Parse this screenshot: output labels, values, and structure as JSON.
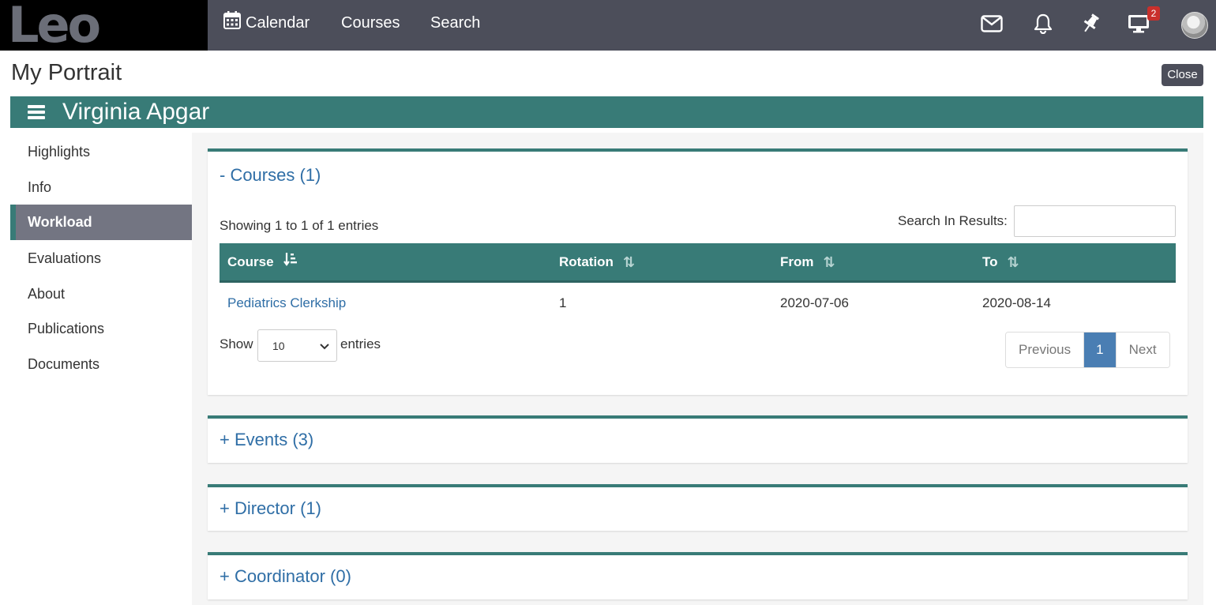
{
  "app": {
    "logo": "Leo"
  },
  "topnav": {
    "calendar": "Calendar",
    "courses": "Courses",
    "search": "Search",
    "notifications_badge": "2",
    "icons": [
      "calendar-icon",
      "mail-icon",
      "bell-icon",
      "pin-icon",
      "monitor-icon"
    ]
  },
  "page": {
    "title": "My Portrait",
    "close_label": "Close"
  },
  "profile": {
    "name": "Virginia Apgar"
  },
  "sidebar": {
    "items": [
      {
        "label": "Highlights"
      },
      {
        "label": "Info"
      },
      {
        "label": "Workload",
        "active": true
      },
      {
        "label": "Evaluations"
      },
      {
        "label": "About"
      },
      {
        "label": "Publications"
      },
      {
        "label": "Documents"
      }
    ]
  },
  "courses_panel": {
    "title": "- Courses (1)",
    "showing": "Showing 1 to 1 of 1 entries",
    "search_label": "Search In Results:",
    "search_value": "",
    "columns": [
      "Course",
      "Rotation",
      "From",
      "To"
    ],
    "rows": [
      {
        "course": "Pediatrics Clerkship",
        "rotation": "1",
        "from": "2020-07-06",
        "to": "2020-08-14"
      }
    ],
    "show_label": "Show",
    "page_size": "10",
    "entries_label": "entries",
    "pagination": {
      "previous": "Previous",
      "current": "1",
      "next": "Next"
    }
  },
  "collapsed_panels": {
    "events": "+ Events (3)",
    "director": "+ Director (1)",
    "coordinator": "+ Coordinator (0)"
  },
  "colors": {
    "topbar": "#4c4e5a",
    "accent_teal": "#387b77",
    "link_blue": "#2f6ea6",
    "active_sidebar": "#737582",
    "pager_active": "#4a7eb3",
    "badge": "#c9302c"
  }
}
